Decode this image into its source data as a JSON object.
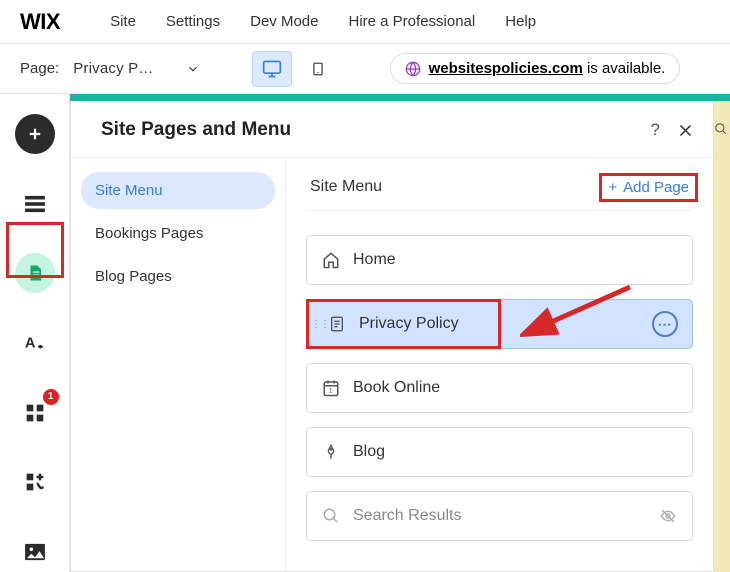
{
  "top": {
    "logo": "WIX",
    "menu": [
      "Site",
      "Settings",
      "Dev Mode",
      "Hire a Professional",
      "Help"
    ]
  },
  "second": {
    "page_label": "Page:",
    "page_name": "Privacy P…",
    "domain_name": "websitespolicies.com",
    "domain_suffix": " is available."
  },
  "rail": {
    "badge_count": "1"
  },
  "panel": {
    "title": "Site Pages and Menu",
    "nav": [
      {
        "label": "Site Menu",
        "active": true
      },
      {
        "label": "Bookings Pages",
        "active": false
      },
      {
        "label": "Blog Pages",
        "active": false
      }
    ],
    "main_title": "Site Menu",
    "add_page_label": "Add Page",
    "pages": {
      "home": "Home",
      "privacy": "Privacy Policy",
      "book": "Book Online",
      "blog": "Blog",
      "search": "Search Results"
    }
  }
}
